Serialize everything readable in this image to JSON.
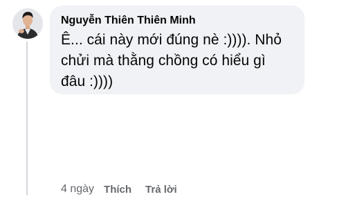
{
  "comment": {
    "author": "Nguyễn Thiên Thiên Minh",
    "text_lines": [
      "Ê... cái này mới đúng nè :)))). Nhỏ",
      "chửi mà thằng chồng có hiểu gì",
      "đâu :))))"
    ],
    "time": "4 ngày",
    "like_label": "Thích",
    "reply_label": "Trả lời"
  },
  "colors": {
    "bubble_bg": "#f0f2f5",
    "meta_text": "#65676b",
    "thread_line": "#d3d6db"
  },
  "icons": {
    "avatar": "profile-photo"
  }
}
